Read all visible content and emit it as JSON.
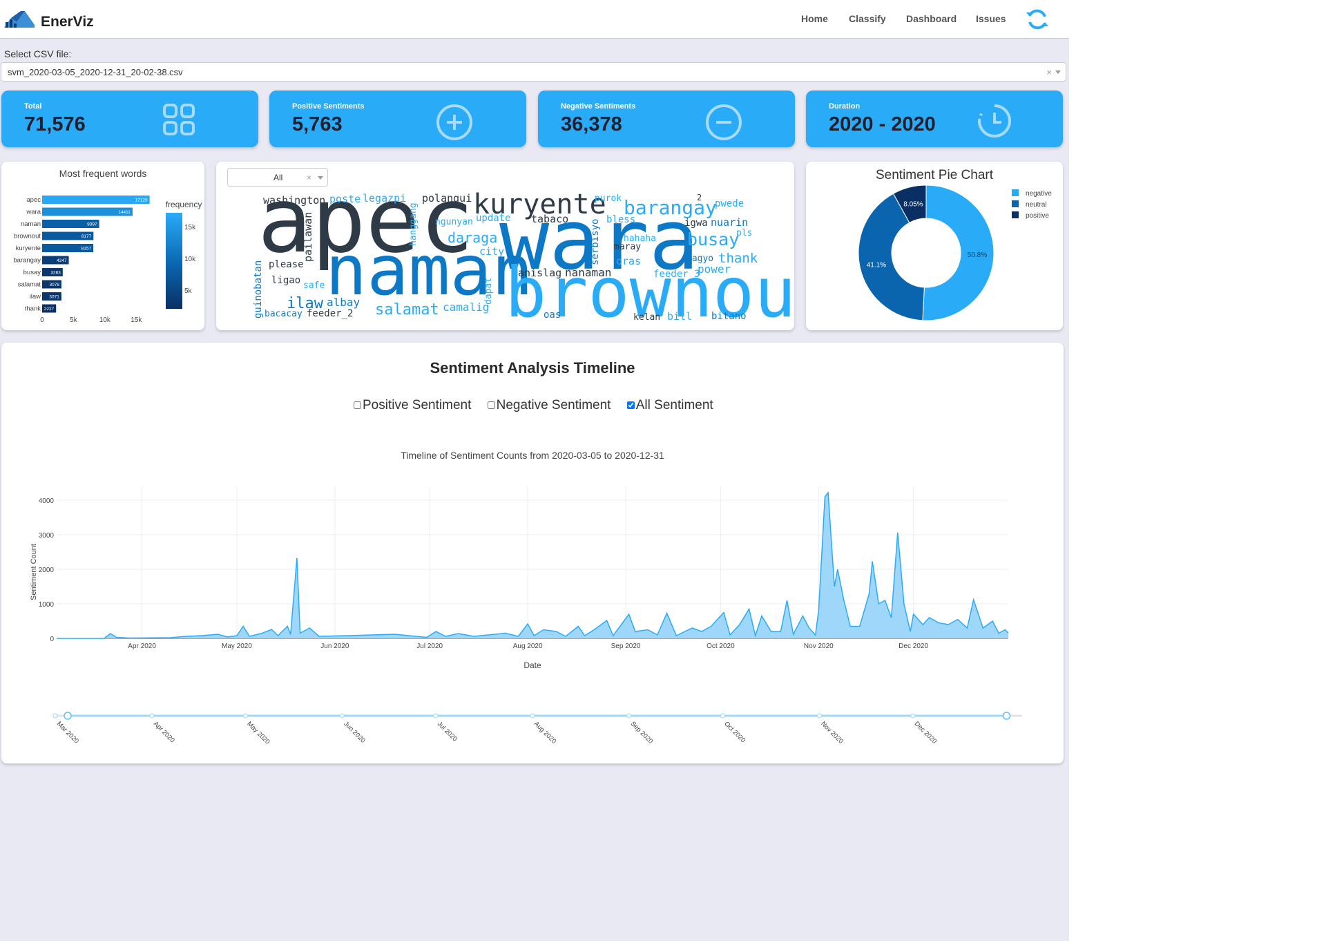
{
  "app": {
    "brand": "EnerViz"
  },
  "nav": {
    "items": [
      "Home",
      "Classify",
      "Dashboard",
      "Issues"
    ]
  },
  "csv": {
    "label": "Select CSV file:",
    "value": "svm_2020-03-05_2020-12-31_20-02-38.csv",
    "clear": "×"
  },
  "stats": [
    {
      "label": "Total",
      "value": "71,576",
      "icon": "grid-icon"
    },
    {
      "label": "Positive Sentiments",
      "value": "5,763",
      "icon": "plus-circle-icon"
    },
    {
      "label": "Negative Sentiments",
      "value": "36,378",
      "icon": "minus-circle-icon"
    },
    {
      "label": "Duration",
      "value": "2020 - 2020",
      "icon": "clock-icon"
    }
  ],
  "colors": {
    "accent": "#29abf8",
    "negative": "#29abf8",
    "neutral": "#0a64ae",
    "positive": "#0a2f63"
  },
  "freq": {
    "title": "Most frequent words",
    "colorbar_title": "frequency",
    "colorbar_ticks": [
      "15k",
      "10k",
      "5k"
    ],
    "x_ticks": [
      "0",
      "5k",
      "10k",
      "15k"
    ],
    "words": [
      "apec",
      "wara",
      "naman",
      "brownout",
      "kuryente",
      "barangay",
      "busay",
      "salamat",
      "ilaw",
      "thank"
    ],
    "values": [
      17129,
      14411,
      9097,
      8177,
      8157,
      4247,
      3283,
      3078,
      3071,
      2227
    ]
  },
  "wordcloud": {
    "filter": "All",
    "clear": "×",
    "words": [
      {
        "t": "apec"
      },
      {
        "t": "wara"
      },
      {
        "t": "naman"
      },
      {
        "t": "brownout"
      },
      {
        "t": "kuryente"
      },
      {
        "t": "barangay"
      },
      {
        "t": "busay"
      },
      {
        "t": "salamat"
      },
      {
        "t": "daraga"
      },
      {
        "t": "ilaw"
      },
      {
        "t": "thank"
      },
      {
        "t": "washington"
      },
      {
        "t": "poste"
      },
      {
        "t": "legazpi"
      },
      {
        "t": "polangui"
      },
      {
        "t": "purok"
      },
      {
        "t": "pwede"
      },
      {
        "t": "2"
      },
      {
        "t": "bless"
      },
      {
        "t": "igwa"
      },
      {
        "t": "nuarin"
      },
      {
        "t": "tabaco"
      },
      {
        "t": "update"
      },
      {
        "t": "ngunyan"
      },
      {
        "t": "pls"
      },
      {
        "t": "hahaha"
      },
      {
        "t": "maray"
      },
      {
        "t": "city"
      },
      {
        "t": "oras"
      },
      {
        "t": "bagyo"
      },
      {
        "t": "power"
      },
      {
        "t": "feeder_3"
      },
      {
        "t": "anislag"
      },
      {
        "t": "nanaman"
      },
      {
        "t": "please"
      },
      {
        "t": "ligao"
      },
      {
        "t": "safe"
      },
      {
        "t": "albay"
      },
      {
        "t": "camalig"
      },
      {
        "t": "feeder_2"
      },
      {
        "t": "bacacay"
      },
      {
        "t": "oas"
      },
      {
        "t": "kelan"
      },
      {
        "t": "bill"
      },
      {
        "t": "bitano"
      },
      {
        "t": "pailawan"
      },
      {
        "t": "hanggang"
      },
      {
        "t": "serbisyo"
      },
      {
        "t": "guinobatan"
      },
      {
        "t": "dapat"
      }
    ]
  },
  "pie": {
    "title": "Sentiment Pie Chart",
    "legend": [
      "negative",
      "neutral",
      "positive"
    ],
    "labels": [
      "50.8%",
      "41.1%",
      "8.05%"
    ],
    "values": [
      50.8,
      41.1,
      8.05
    ]
  },
  "timeline": {
    "title": "Sentiment Analysis Timeline",
    "checkboxes": [
      {
        "label": "Positive Sentiment",
        "checked": false
      },
      {
        "label": "Negative Sentiment",
        "checked": false
      },
      {
        "label": "All Sentiment",
        "checked": true
      }
    ]
  },
  "chart_data": {
    "type": "area",
    "title": "Timeline of Sentiment Counts from 2020-03-05 to 2020-12-31",
    "xlabel": "Date",
    "ylabel": "Sentiment Count",
    "x_range": [
      "2020-03-05",
      "2020-12-31"
    ],
    "ylim": [
      0,
      4400
    ],
    "y_ticks": [
      0,
      1000,
      2000,
      3000,
      4000
    ],
    "x_ticks": [
      "Apr 2020",
      "May 2020",
      "Jun 2020",
      "Jul 2020",
      "Aug 2020",
      "Sep 2020",
      "Oct 2020",
      "Nov 2020",
      "Dec 2020"
    ],
    "grid": true,
    "x_tick_dates": [
      "2020-04-01",
      "2020-05-01",
      "2020-06-01",
      "2020-07-01",
      "2020-08-01",
      "2020-09-01",
      "2020-10-01",
      "2020-11-01",
      "2020-12-01"
    ],
    "rangeslider_ticks": [
      "Mar 2020",
      "Apr 2020",
      "May 2020",
      "Jun 2020",
      "Jul 2020",
      "Aug 2020",
      "Sep 2020",
      "Oct 2020",
      "Nov 2020",
      "Dec 2020"
    ],
    "rangeslider_tick_dates": [
      "2020-03-01",
      "2020-04-01",
      "2020-05-01",
      "2020-06-01",
      "2020-07-01",
      "2020-08-01",
      "2020-09-01",
      "2020-10-01",
      "2020-11-01",
      "2020-12-01"
    ],
    "series": [
      {
        "points": [
          [
            "2020-03-05",
            0
          ],
          [
            "2020-03-20",
            0
          ],
          [
            "2020-03-22",
            140
          ],
          [
            "2020-03-24",
            30
          ],
          [
            "2020-03-28",
            10
          ],
          [
            "2020-04-10",
            20
          ],
          [
            "2020-04-15",
            60
          ],
          [
            "2020-04-20",
            80
          ],
          [
            "2020-04-25",
            120
          ],
          [
            "2020-04-28",
            40
          ],
          [
            "2020-05-01",
            80
          ],
          [
            "2020-05-03",
            350
          ],
          [
            "2020-05-05",
            60
          ],
          [
            "2020-05-09",
            150
          ],
          [
            "2020-05-12",
            260
          ],
          [
            "2020-05-14",
            80
          ],
          [
            "2020-05-17",
            350
          ],
          [
            "2020-05-18",
            120
          ],
          [
            "2020-05-20",
            2330
          ],
          [
            "2020-05-21",
            150
          ],
          [
            "2020-05-24",
            300
          ],
          [
            "2020-05-27",
            60
          ],
          [
            "2020-06-05",
            80
          ],
          [
            "2020-06-20",
            120
          ],
          [
            "2020-06-30",
            30
          ],
          [
            "2020-07-03",
            200
          ],
          [
            "2020-07-06",
            60
          ],
          [
            "2020-07-10",
            140
          ],
          [
            "2020-07-15",
            60
          ],
          [
            "2020-07-25",
            150
          ],
          [
            "2020-07-29",
            60
          ],
          [
            "2020-08-01",
            420
          ],
          [
            "2020-08-03",
            80
          ],
          [
            "2020-08-06",
            250
          ],
          [
            "2020-08-10",
            200
          ],
          [
            "2020-08-13",
            60
          ],
          [
            "2020-08-17",
            350
          ],
          [
            "2020-08-19",
            80
          ],
          [
            "2020-08-22",
            250
          ],
          [
            "2020-08-26",
            520
          ],
          [
            "2020-08-28",
            80
          ],
          [
            "2020-08-31",
            450
          ],
          [
            "2020-09-02",
            700
          ],
          [
            "2020-09-04",
            200
          ],
          [
            "2020-09-08",
            250
          ],
          [
            "2020-09-11",
            100
          ],
          [
            "2020-09-14",
            730
          ],
          [
            "2020-09-17",
            80
          ],
          [
            "2020-09-22",
            300
          ],
          [
            "2020-09-25",
            200
          ],
          [
            "2020-09-28",
            350
          ],
          [
            "2020-10-02",
            750
          ],
          [
            "2020-10-04",
            100
          ],
          [
            "2020-10-07",
            400
          ],
          [
            "2020-10-10",
            850
          ],
          [
            "2020-10-12",
            80
          ],
          [
            "2020-10-14",
            650
          ],
          [
            "2020-10-17",
            200
          ],
          [
            "2020-10-20",
            200
          ],
          [
            "2020-10-22",
            1100
          ],
          [
            "2020-10-24",
            120
          ],
          [
            "2020-10-27",
            650
          ],
          [
            "2020-10-29",
            300
          ],
          [
            "2020-10-31",
            100
          ],
          [
            "2020-11-01",
            800
          ],
          [
            "2020-11-03",
            4100
          ],
          [
            "2020-11-04",
            4220
          ],
          [
            "2020-11-06",
            1500
          ],
          [
            "2020-11-07",
            2000
          ],
          [
            "2020-11-09",
            1100
          ],
          [
            "2020-11-11",
            350
          ],
          [
            "2020-11-14",
            350
          ],
          [
            "2020-11-17",
            1300
          ],
          [
            "2020-11-18",
            2230
          ],
          [
            "2020-11-20",
            1000
          ],
          [
            "2020-11-22",
            1100
          ],
          [
            "2020-11-24",
            600
          ],
          [
            "2020-11-26",
            3060
          ],
          [
            "2020-11-28",
            1000
          ],
          [
            "2020-11-30",
            200
          ],
          [
            "2020-12-01",
            700
          ],
          [
            "2020-12-04",
            400
          ],
          [
            "2020-12-06",
            600
          ],
          [
            "2020-12-09",
            450
          ],
          [
            "2020-12-12",
            400
          ],
          [
            "2020-12-15",
            550
          ],
          [
            "2020-12-18",
            300
          ],
          [
            "2020-12-20",
            1120
          ],
          [
            "2020-12-23",
            300
          ],
          [
            "2020-12-26",
            500
          ],
          [
            "2020-12-28",
            150
          ],
          [
            "2020-12-30",
            250
          ],
          [
            "2020-12-31",
            150
          ]
        ]
      }
    ]
  }
}
